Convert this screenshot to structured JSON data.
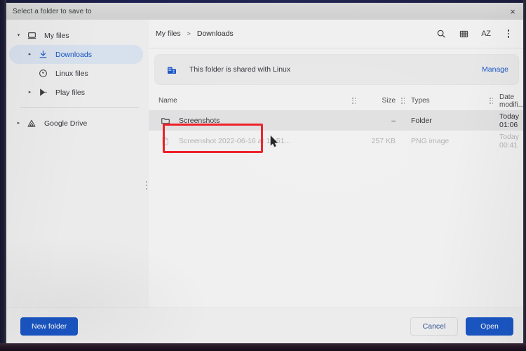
{
  "window": {
    "title": "Select a folder to save to",
    "close_label": "×"
  },
  "sidebar": {
    "items": [
      {
        "label": "My files",
        "icon": "computer-icon",
        "twisty": "▾",
        "selected": false,
        "indent": false
      },
      {
        "label": "Downloads",
        "icon": "download-icon",
        "twisty": "▸",
        "selected": true,
        "indent": true
      },
      {
        "label": "Linux files",
        "icon": "linux-icon",
        "twisty": "",
        "selected": false,
        "indent": true
      },
      {
        "label": "Play files",
        "icon": "play-store-icon",
        "twisty": "▸",
        "selected": false,
        "indent": true
      },
      {
        "label": "Google Drive",
        "icon": "google-drive-icon",
        "twisty": "▸",
        "selected": false,
        "indent": false
      }
    ]
  },
  "toolbar": {
    "breadcrumb": {
      "root": "My files",
      "separator": ">",
      "current": "Downloads"
    },
    "buttons": [
      {
        "name": "search-icon",
        "label": "Search"
      },
      {
        "name": "grid-view-icon",
        "label": "Switch to grid view"
      },
      {
        "name": "sort-az-icon",
        "label": "AZ"
      },
      {
        "name": "more-options-icon",
        "label": "More options"
      }
    ],
    "sort_az_label": "AZ"
  },
  "banner": {
    "icon": "linux-share-icon",
    "text": "This folder is shared with Linux",
    "action_label": "Manage"
  },
  "file_list": {
    "columns": [
      {
        "key": "name",
        "label": "Name"
      },
      {
        "key": "size",
        "label": "Size"
      },
      {
        "key": "types",
        "label": "Types"
      },
      {
        "key": "date",
        "label": "Date modifi..."
      }
    ],
    "sort_indicator": "↓",
    "rows": [
      {
        "name": "Screenshots",
        "size": "–",
        "types": "Folder",
        "date": "Today 01:06",
        "icon": "folder-icon",
        "selected": true,
        "disabled": false
      },
      {
        "name": "Screenshot 2022-06-16 at 12.51...",
        "size": "257 KB",
        "types": "PNG image",
        "date": "Today 00:41",
        "icon": "image-file-icon",
        "selected": false,
        "disabled": true
      }
    ]
  },
  "footer": {
    "new_folder_label": "New folder",
    "cancel_label": "Cancel",
    "open_label": "Open"
  },
  "colors": {
    "accent_blue": "#1a56c4",
    "selected_nav_bg": "#d7e0ed",
    "annotation_red": "#ee1b24",
    "row_selected_bg": "#e0e0e1"
  }
}
